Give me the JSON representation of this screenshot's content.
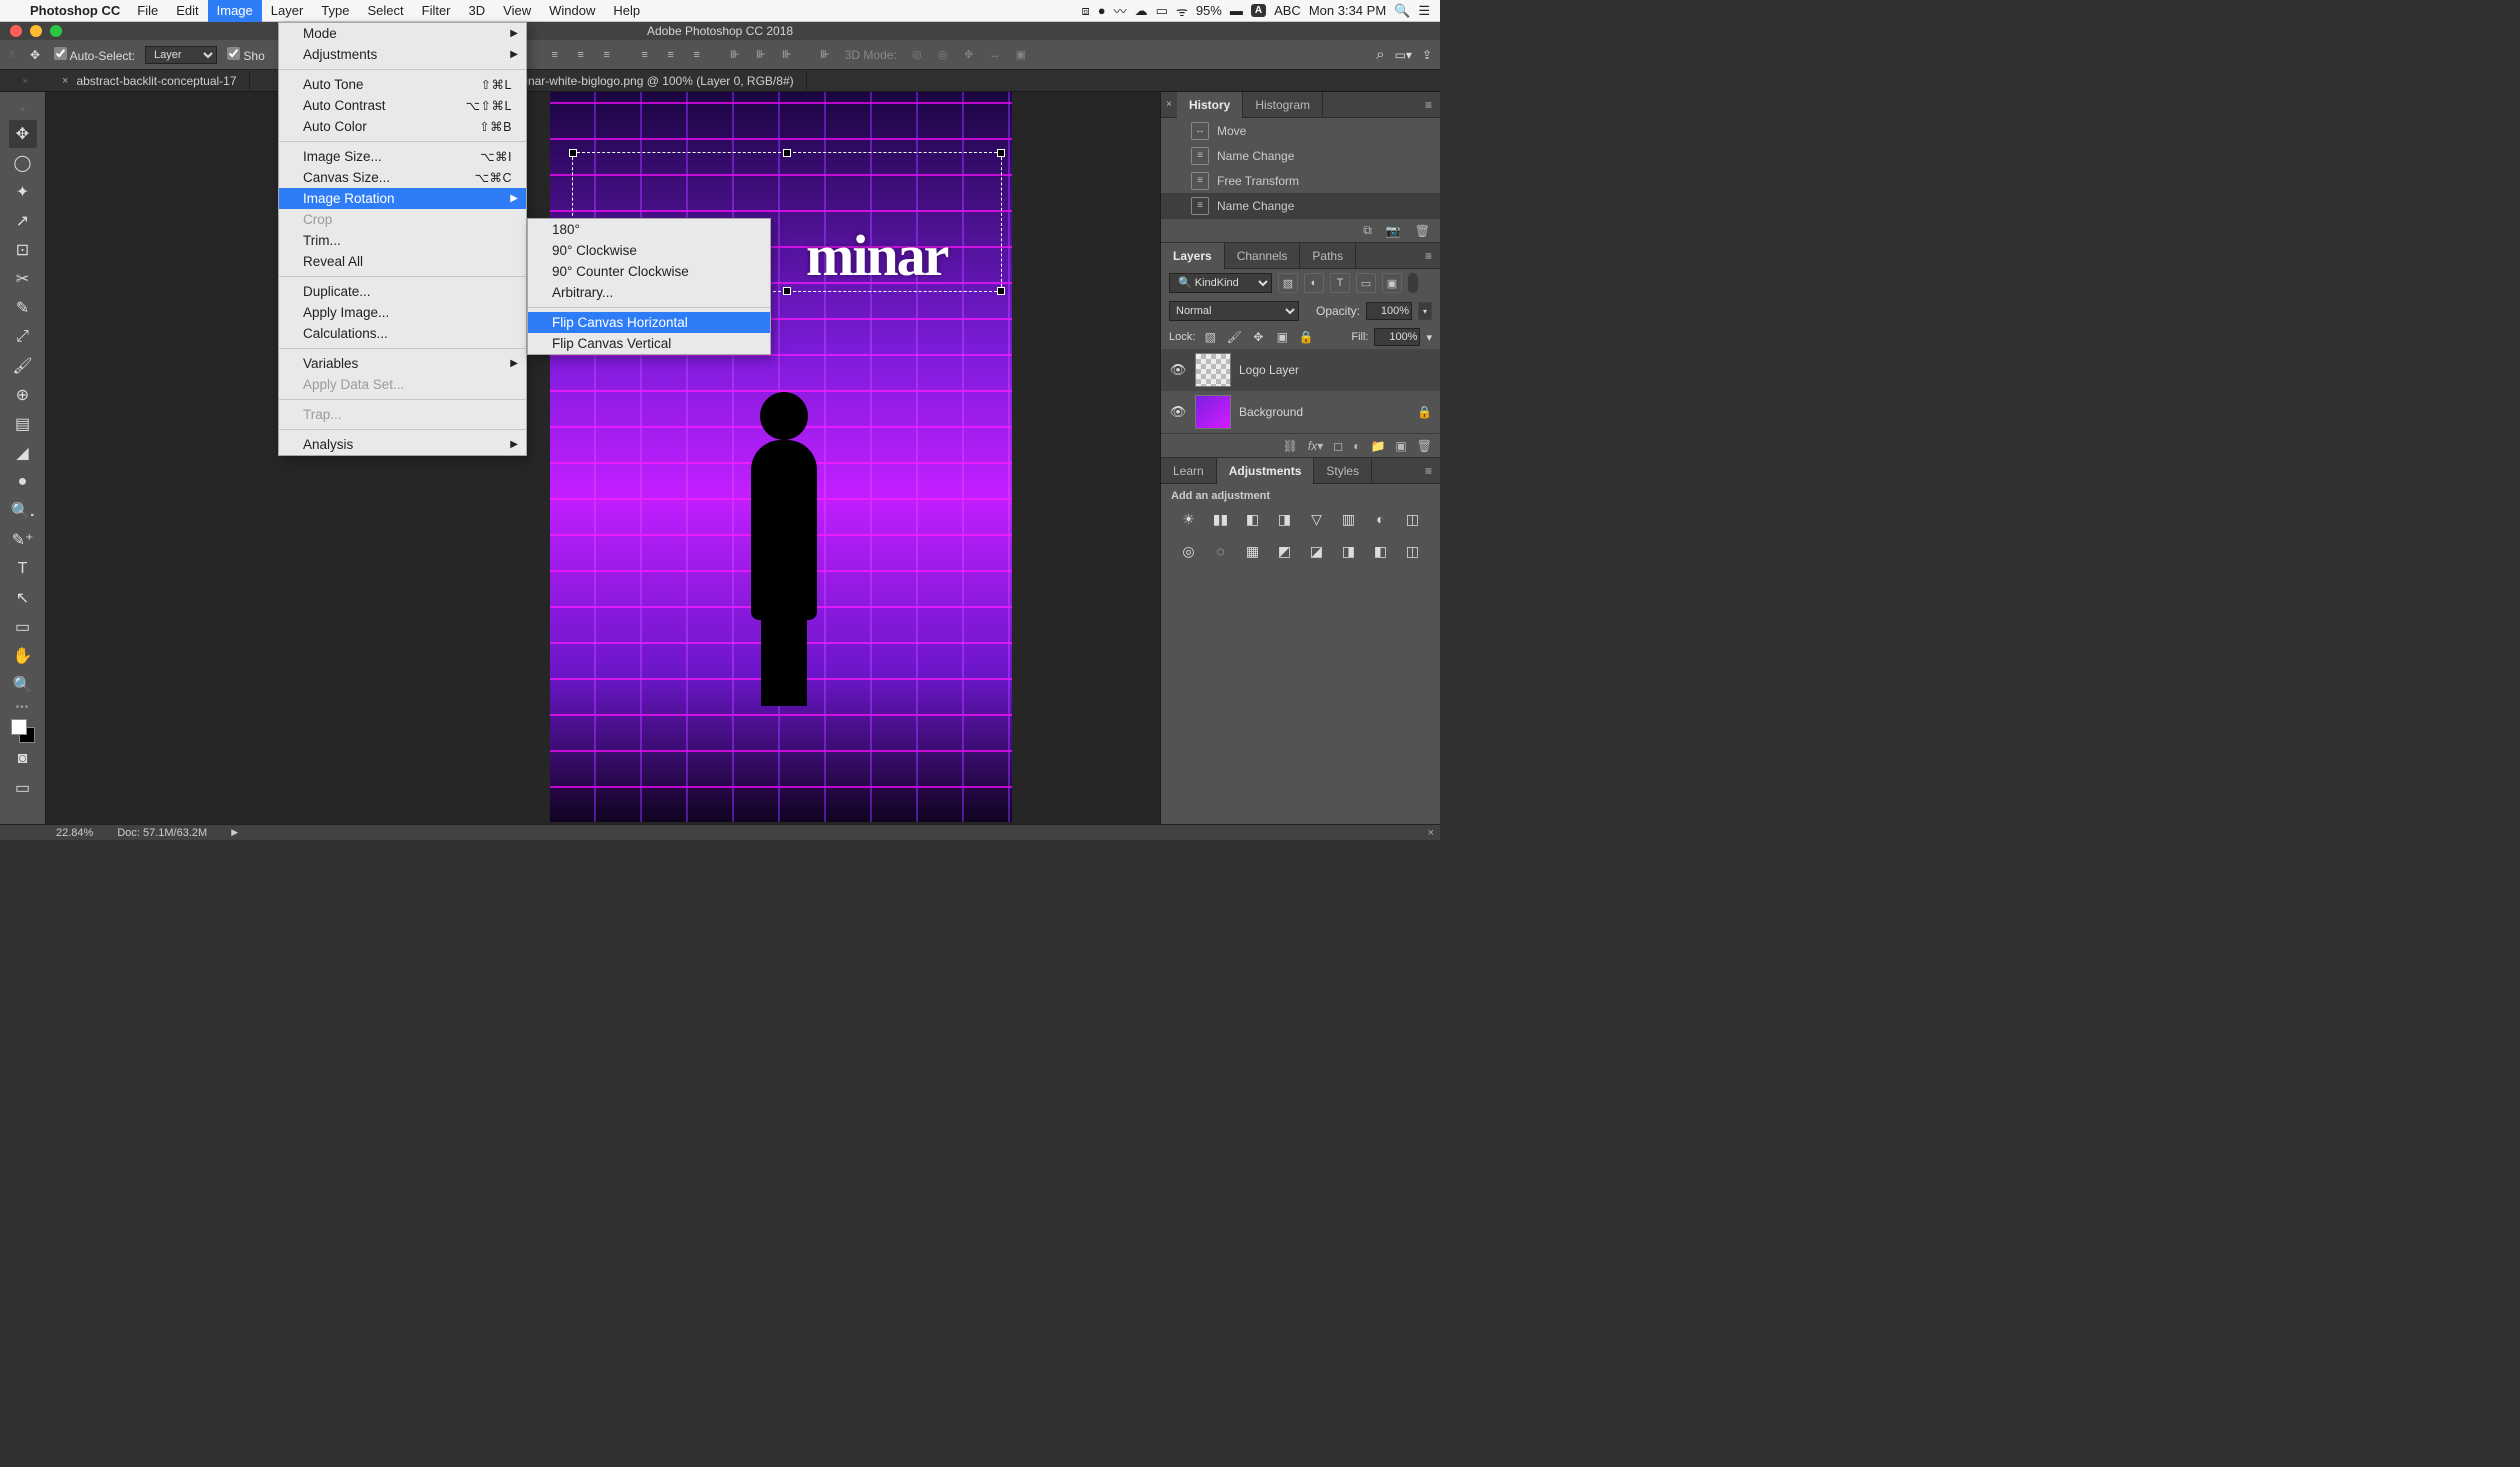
{
  "menubar": {
    "app": "Photoshop CC",
    "items": [
      "File",
      "Edit",
      "Image",
      "Layer",
      "Type",
      "Select",
      "Filter",
      "3D",
      "View",
      "Window",
      "Help"
    ],
    "open_index": 2,
    "battery_pct": "95%",
    "kb_badge": "ABC",
    "clock": "Mon 3:34 PM"
  },
  "window_title": "Adobe Photoshop CC 2018",
  "options_bar": {
    "auto_select_label": "Auto-Select:",
    "auto_select_kind": "Layer",
    "show_tc_label": "Sho",
    "mode_label": "3D Mode:"
  },
  "doc_tabs": [
    {
      "label": "abstract-backlit-conceptual-17",
      "close": "×"
    },
    {
      "label": "luminar-white-biglogo.png @ 100% (Layer 0, RGB/8#)",
      "close": "×"
    }
  ],
  "image_menu": {
    "groups": [
      [
        {
          "label": "Mode",
          "sub": true,
          "dis": false
        },
        {
          "label": "Adjustments",
          "sub": true,
          "dis": false
        }
      ],
      [
        {
          "label": "Auto Tone",
          "kb": "⇧⌘L"
        },
        {
          "label": "Auto Contrast",
          "kb": "⌥⇧⌘L"
        },
        {
          "label": "Auto Color",
          "kb": "⇧⌘B"
        }
      ],
      [
        {
          "label": "Image Size...",
          "kb": "⌥⌘I"
        },
        {
          "label": "Canvas Size...",
          "kb": "⌥⌘C"
        },
        {
          "label": "Image Rotation",
          "sub": true,
          "hi": true
        },
        {
          "label": "Crop",
          "dis": true
        },
        {
          "label": "Trim...",
          "dis": false
        },
        {
          "label": "Reveal All",
          "dis": false
        }
      ],
      [
        {
          "label": "Duplicate..."
        },
        {
          "label": "Apply Image..."
        },
        {
          "label": "Calculations..."
        }
      ],
      [
        {
          "label": "Variables",
          "sub": true
        },
        {
          "label": "Apply Data Set...",
          "dis": true
        }
      ],
      [
        {
          "label": "Trap...",
          "dis": true
        }
      ],
      [
        {
          "label": "Analysis",
          "sub": true
        }
      ]
    ]
  },
  "rotation_submenu": {
    "groups": [
      [
        {
          "label": "180°"
        },
        {
          "label": "90° Clockwise"
        },
        {
          "label": "90° Counter Clockwise"
        },
        {
          "label": "Arbitrary..."
        }
      ],
      [
        {
          "label": "Flip Canvas Horizontal",
          "hi": true
        },
        {
          "label": "Flip Canvas Vertical"
        }
      ]
    ]
  },
  "tools": [
    "✥",
    "◯",
    "✦",
    "↗",
    "⊡",
    "✂",
    "✎",
    "⤢",
    "🖌",
    "⊕",
    "▤",
    "◢",
    "●",
    "🔍᎐",
    "✎⁺",
    "T",
    "↖",
    "▭",
    "✋",
    "🔍"
  ],
  "canvas_text": "minar",
  "history_panel": {
    "tabs": [
      "History",
      "Histogram"
    ],
    "active": 0,
    "items": [
      {
        "icon": "↔",
        "label": "Move"
      },
      {
        "icon": "≡",
        "label": "Name Change"
      },
      {
        "icon": "≡",
        "label": "Free Transform"
      },
      {
        "icon": "≡",
        "label": "Name Change",
        "active": true
      }
    ]
  },
  "layers_panel": {
    "tabs": [
      "Layers",
      "Channels",
      "Paths"
    ],
    "active": 0,
    "filter_kind": "Kind",
    "blend_mode": "Normal",
    "opacity_label": "Opacity:",
    "opacity": "100%",
    "lock_label": "Lock:",
    "fill_label": "Fill:",
    "fill": "100%",
    "layers": [
      {
        "name": "Logo Layer",
        "thumb": "chk",
        "selected": true,
        "locked": false
      },
      {
        "name": "Background",
        "thumb": "img",
        "selected": false,
        "locked": true
      }
    ]
  },
  "adjust_panel": {
    "tabs": [
      "Learn",
      "Adjustments",
      "Styles"
    ],
    "active": 1,
    "hint": "Add an adjustment",
    "icons": [
      "☀",
      "▮▮",
      "◧",
      "◨",
      "▽",
      "▥",
      "◐",
      "◫",
      "◎",
      "◌",
      "▦",
      "◩",
      "◪",
      "◨",
      "◧",
      "◫"
    ]
  },
  "status": {
    "zoom": "22.84%",
    "doc": "Doc: 57.1M/63.2M"
  }
}
